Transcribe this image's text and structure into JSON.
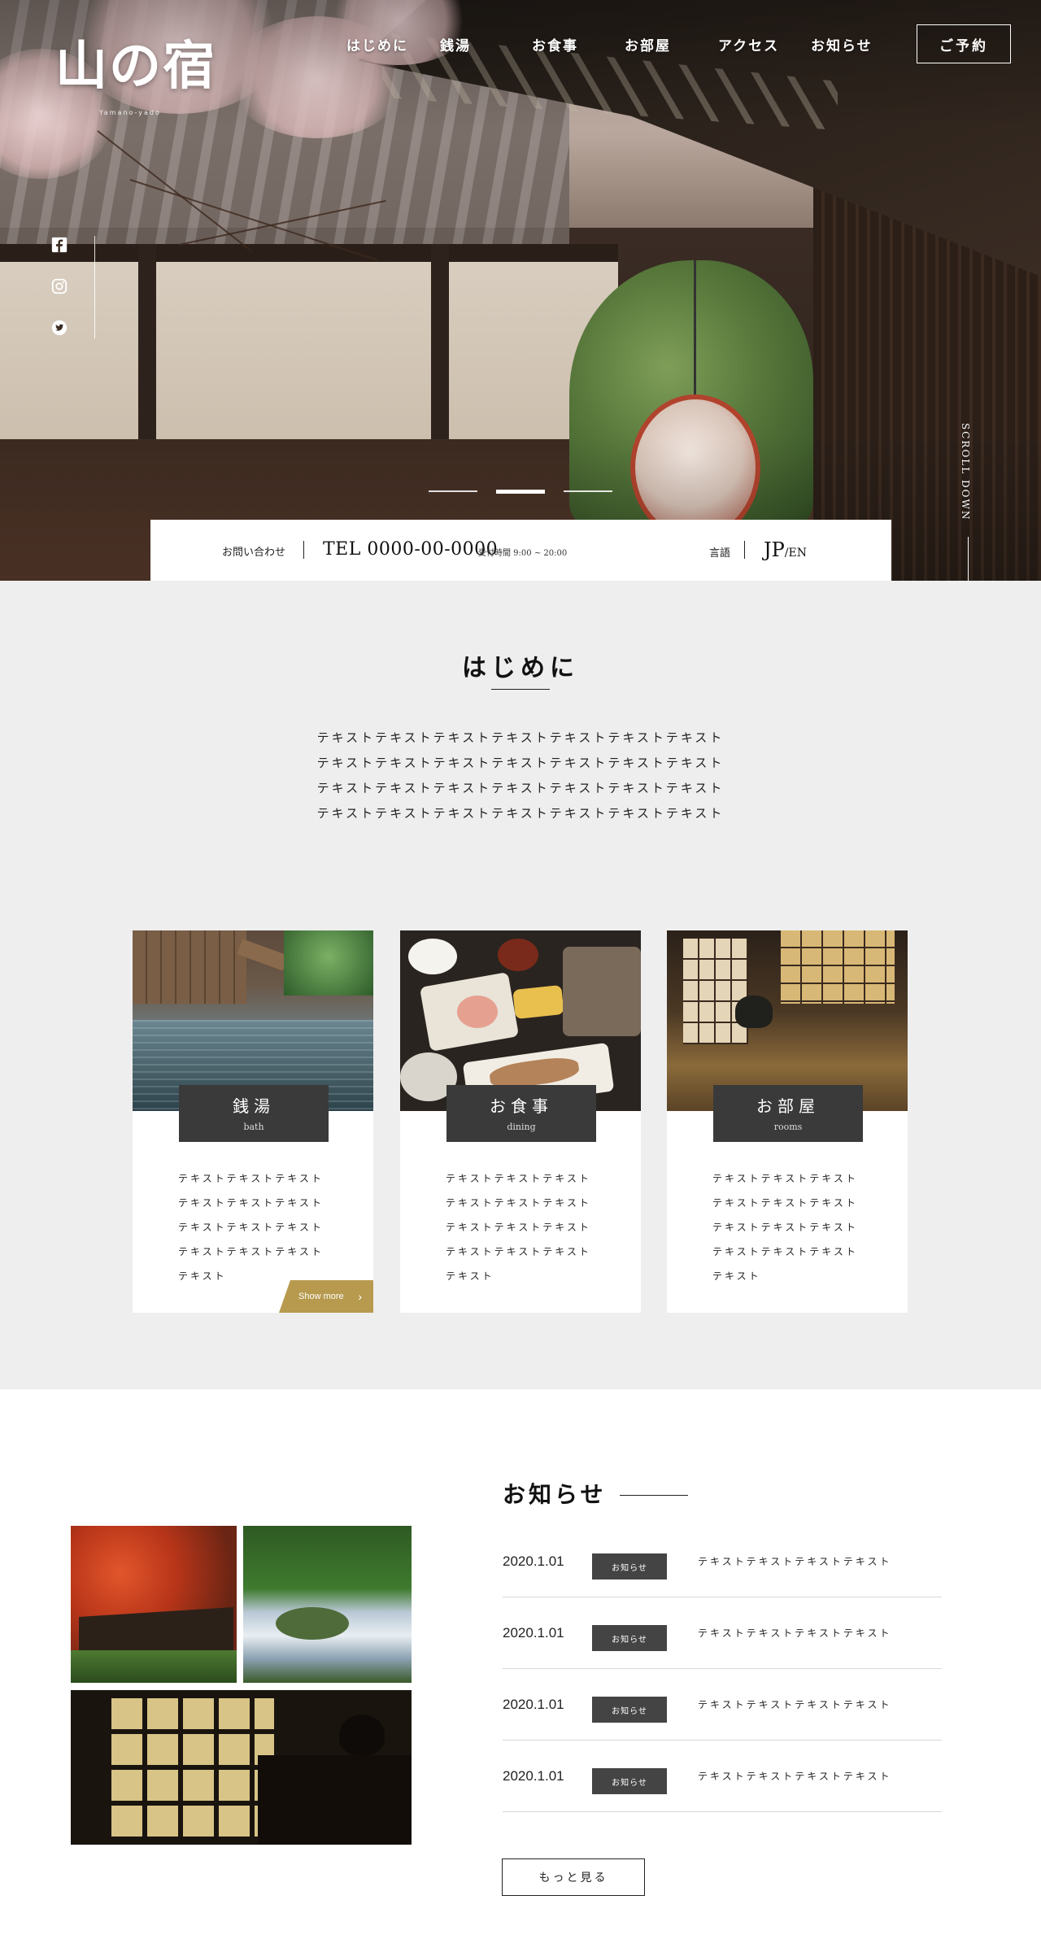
{
  "header": {
    "logo_text": "山の宿",
    "logo_sub": "Yamano-yado",
    "nav": [
      {
        "label": "はじめに"
      },
      {
        "label": "銭湯"
      },
      {
        "label": "お食事"
      },
      {
        "label": "お部屋"
      },
      {
        "label": "アクセス"
      },
      {
        "label": "お知らせ"
      }
    ],
    "reserve_label": "ご予約"
  },
  "social": [
    "facebook-icon",
    "instagram-icon",
    "twitter-icon"
  ],
  "hero": {
    "slides_total": 3,
    "active_slide": 2,
    "scroll_label": "SCROLL DOWN"
  },
  "contact": {
    "label": "お問い合わせ",
    "tel": "TEL 0000-00-0000",
    "hours": "受付時間 9:00 ~ 20:00",
    "lang_label": "言語",
    "lang_jp": "JP",
    "lang_en": "/EN"
  },
  "intro": {
    "title": "はじめに",
    "lines": [
      "テキストテキストテキストテキストテキストテキストテキスト",
      "テキストテキストテキストテキストテキストテキストテキスト",
      "テキストテキストテキストテキストテキストテキストテキスト",
      "テキストテキストテキストテキストテキストテキストテキスト"
    ]
  },
  "cards": [
    {
      "title": "銭湯",
      "subtitle": "bath",
      "text": "テキストテキストテキストテキストテキストテキストテキストテキストテキストテキストテキストテキストテキスト",
      "show_more": "Show more"
    },
    {
      "title": "お食事",
      "subtitle": "dining",
      "text": "テキストテキストテキストテキストテキストテキストテキストテキストテキストテキストテキストテキストテキスト"
    },
    {
      "title": "お部屋",
      "subtitle": "rooms",
      "text": "テキストテキストテキストテキストテキストテキストテキストテキストテキストテキストテキストテキストテキスト"
    }
  ],
  "news": {
    "title": "お知らせ",
    "items": [
      {
        "date": "2020.1.01",
        "category": "お知らせ",
        "text": "テキストテキストテキストテキスト"
      },
      {
        "date": "2020.1.01",
        "category": "お知らせ",
        "text": "テキストテキストテキストテキスト"
      },
      {
        "date": "2020.1.01",
        "category": "お知らせ",
        "text": "テキストテキストテキストテキスト"
      },
      {
        "date": "2020.1.01",
        "category": "お知らせ",
        "text": "テキストテキストテキストテキスト"
      }
    ],
    "more_label": "もっと見る"
  },
  "colors": {
    "background_gray": "#eeeeee",
    "tag_dark": "#3a3a3a",
    "accent_gold": "#b79a4e"
  }
}
